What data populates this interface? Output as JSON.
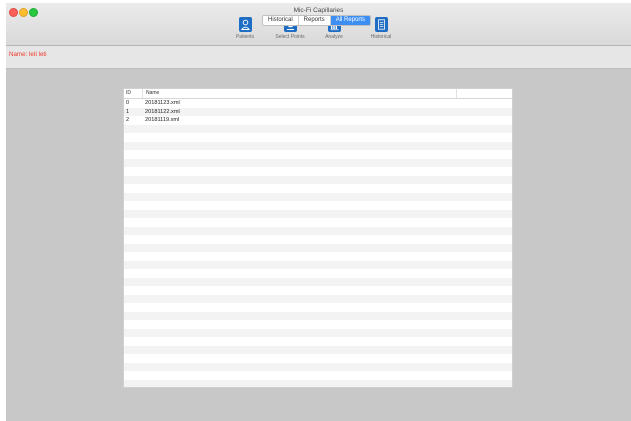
{
  "window": {
    "title": "Mic-Fi Capillaries"
  },
  "toolbar": {
    "items": [
      {
        "label": "Patients",
        "icon": "person-icon"
      },
      {
        "label": "Select Points",
        "icon": "select-points-icon"
      },
      {
        "label": "Analyze",
        "icon": "bar-chart-icon"
      },
      {
        "label": "Historical",
        "icon": "document-list-icon"
      }
    ]
  },
  "patient": {
    "name_text": "Name: leti leti"
  },
  "tabs": [
    {
      "label": "Historical",
      "active": false
    },
    {
      "label": "Reports",
      "active": false
    },
    {
      "label": "All Reports",
      "active": true
    }
  ],
  "table": {
    "columns": [
      "ID",
      "Name"
    ],
    "rows": [
      {
        "id": "0",
        "name": "20181123.xml"
      },
      {
        "id": "1",
        "name": "20181122.xml"
      },
      {
        "id": "2",
        "name": "20181119.xml"
      }
    ]
  },
  "colors": {
    "accent": "#3d8ef2",
    "toolbar_icon": "#1f6ec4",
    "patient_name": "#f0382b",
    "window_bg": "#c8c8c8"
  }
}
